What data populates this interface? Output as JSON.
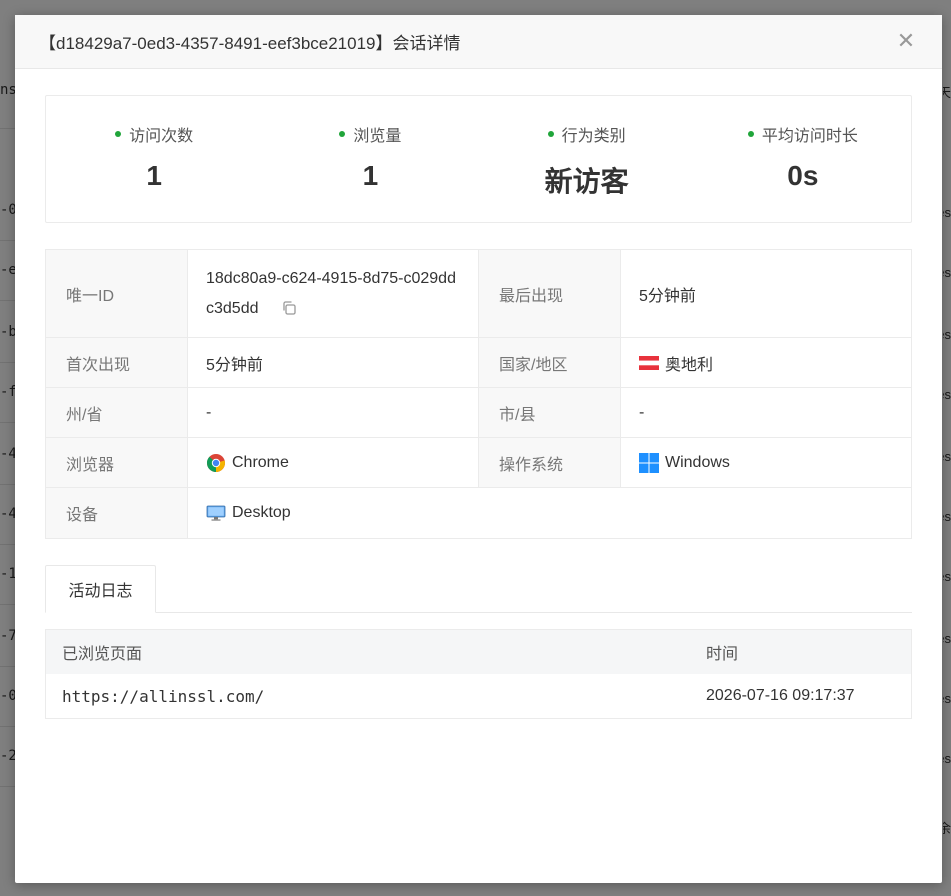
{
  "background": {
    "left_items": [
      "ns",
      "-0",
      "-e",
      "-b",
      "-f",
      "-4",
      "-4",
      "-1",
      "-7",
      "-0",
      "-2"
    ],
    "right_items": [
      "天",
      "es",
      "es",
      "es",
      "es",
      "es",
      "es",
      "es",
      "es",
      "es",
      "es",
      "余"
    ]
  },
  "modal": {
    "title": "【d18429a7-0ed3-4357-8491-eef3bce21019】会话详情",
    "close_glyph": "✕"
  },
  "stats": [
    {
      "label": "访问次数",
      "value": "1"
    },
    {
      "label": "浏览量",
      "value": "1"
    },
    {
      "label": "行为类别",
      "value": "新访客"
    },
    {
      "label": "平均访问时长",
      "value": "0s"
    }
  ],
  "info": {
    "uid_label": "唯一ID",
    "uid_value": "18dc80a9-c624-4915-8d75-c029ddc3d5dd",
    "last_seen_label": "最后出现",
    "last_seen_value": "5分钟前",
    "first_seen_label": "首次出现",
    "first_seen_value": "5分钟前",
    "country_label": "国家/地区",
    "country_value": "奥地利",
    "state_label": "州/省",
    "state_value": "-",
    "city_label": "市/县",
    "city_value": "-",
    "browser_label": "浏览器",
    "browser_value": "Chrome",
    "os_label": "操作系统",
    "os_value": "Windows",
    "device_label": "设备",
    "device_value": "Desktop"
  },
  "tabs": [
    {
      "label": "活动日志",
      "active": true
    }
  ],
  "log": {
    "headers": {
      "page": "已浏览页面",
      "time": "时间"
    },
    "rows": [
      {
        "page": "https://allinssl.com/",
        "time": "2026-07-16 09:17:37"
      }
    ]
  },
  "icons": {
    "stat_dot": "green-dot-icon",
    "copy": "copy-icon",
    "flag": "austria-flag-icon",
    "browser": "chrome-icon",
    "os": "windows-icon",
    "device": "desktop-monitor-icon"
  },
  "colors": {
    "accent_green": "#20a53a",
    "header_bg": "#f8f8f8",
    "label_bg": "#f8f8f8"
  }
}
